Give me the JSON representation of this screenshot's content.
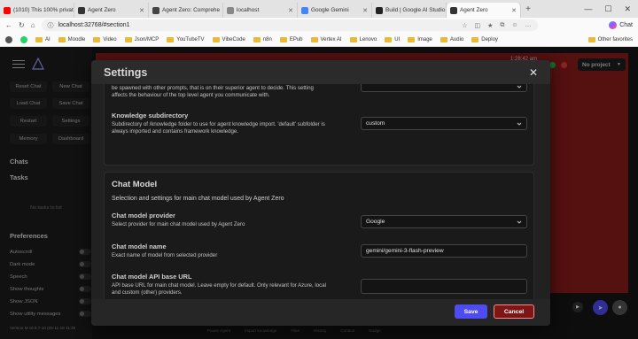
{
  "browser": {
    "tabs": [
      {
        "title": "(1010) This 100% privat",
        "favicon_color": "#ff0000"
      },
      {
        "title": "Agent Zero",
        "favicon_color": "#333333"
      },
      {
        "title": "Agent Zero: Comprehe",
        "favicon_color": "#444444"
      },
      {
        "title": "localhost",
        "favicon_color": "#888888"
      },
      {
        "title": "Google Gemini",
        "favicon_color": "#4285f4"
      },
      {
        "title": "Build | Google AI Studio",
        "favicon_color": "#222222"
      },
      {
        "title": "Agent Zero",
        "favicon_color": "#333333",
        "active": true
      }
    ],
    "url": "localhost:32768/#section1",
    "copilot_label": "Chat",
    "bookmarks": [
      "AI",
      "Moodle",
      "Video",
      "Json/MCP",
      "YouTubeTV",
      "VibeCode",
      "n8n",
      "EPub",
      "Vertex AI",
      "Lenovo",
      "UI",
      "Image",
      "Audio",
      "Deploy"
    ],
    "other_favorites": "Other favorites"
  },
  "app": {
    "sidebar": {
      "buttons": [
        "Reset Chat",
        "New Chat",
        "Load Chat",
        "Save Chat",
        "Restart",
        "Settings",
        "Memory",
        "Dashboard"
      ],
      "chats_heading": "Chats",
      "tasks_heading": "Tasks",
      "no_tasks": "No tasks to list",
      "preferences_heading": "Preferences",
      "preferences": [
        "Autoscroll",
        "Dark mode",
        "Speech",
        "Show thoughts",
        "Show JSON",
        "Show utility messages"
      ],
      "version": "Version M v0.9.7-10 (05-11-19 11:36"
    },
    "header": {
      "clock": "1:28:42 am",
      "project_select": "No project"
    },
    "bottom_tools": [
      "Pause Agent",
      "Import knowledge",
      "Files",
      "History",
      "Context",
      "Nudge"
    ],
    "status_colors": {
      "ok": "#1fb34a",
      "warn": "#e03a3a",
      "idle": "#cfcfcf"
    }
  },
  "settings_modal": {
    "title": "Settings",
    "close_glyph": "✕",
    "top_section": {
      "intro_partial_1": "be spawned with other prompts, that is on their superior agent to decide. This setting",
      "intro_partial_2": "affects the behaviour of the top level agent you communicate with.",
      "knowledge": {
        "label": "Knowledge subdirectory",
        "desc_1": "Subdirectory of /knowledge folder to use for agent knowledge import. 'default' subfolder is",
        "desc_2": "always imported and contains framework knowledge.",
        "value": "custom"
      }
    },
    "chat_model": {
      "title": "Chat Model",
      "description": "Selection and settings for main chat model used by Agent Zero",
      "provider": {
        "label": "Chat model provider",
        "desc": "Select provider for main chat model used by Agent Zero",
        "value": "Google"
      },
      "model_name": {
        "label": "Chat model name",
        "desc": "Exact name of model from selected provider",
        "value": "gemini/gemini-3-flash-preview"
      },
      "api_base": {
        "label": "Chat model API base URL",
        "desc_1": "API base URL for main chat model. Leave empty for default. Only relevant for Azure, local",
        "desc_2": "and custom (other) providers.",
        "value": ""
      }
    },
    "footer": {
      "save": "Save",
      "cancel": "Cancel"
    }
  },
  "colors": {
    "accent": "#4e4bf0",
    "danger": "#7d1616",
    "danger_border": "#ff8a8a",
    "app_alert_bg": "#8a1b1b"
  }
}
